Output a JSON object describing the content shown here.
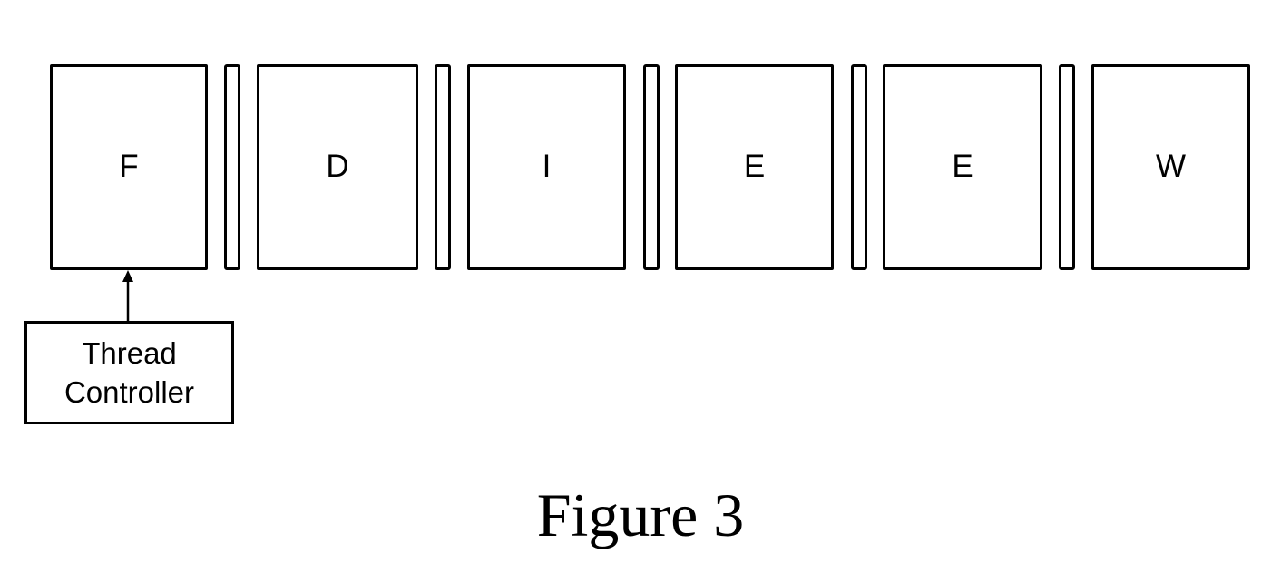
{
  "figure": {
    "caption": "Figure 3",
    "pipeline": {
      "stages": [
        {
          "id": "fetch",
          "label": "F"
        },
        {
          "id": "decode",
          "label": "D"
        },
        {
          "id": "issue",
          "label": "I"
        },
        {
          "id": "execute1",
          "label": "E"
        },
        {
          "id": "execute2",
          "label": "E"
        },
        {
          "id": "writeback",
          "label": "W"
        }
      ],
      "latch_count": 5
    },
    "controller": {
      "lines": [
        "Thread",
        "Controller"
      ],
      "connects_to": "F"
    },
    "colors": {
      "stroke": "#000000",
      "background": "#ffffff"
    }
  }
}
